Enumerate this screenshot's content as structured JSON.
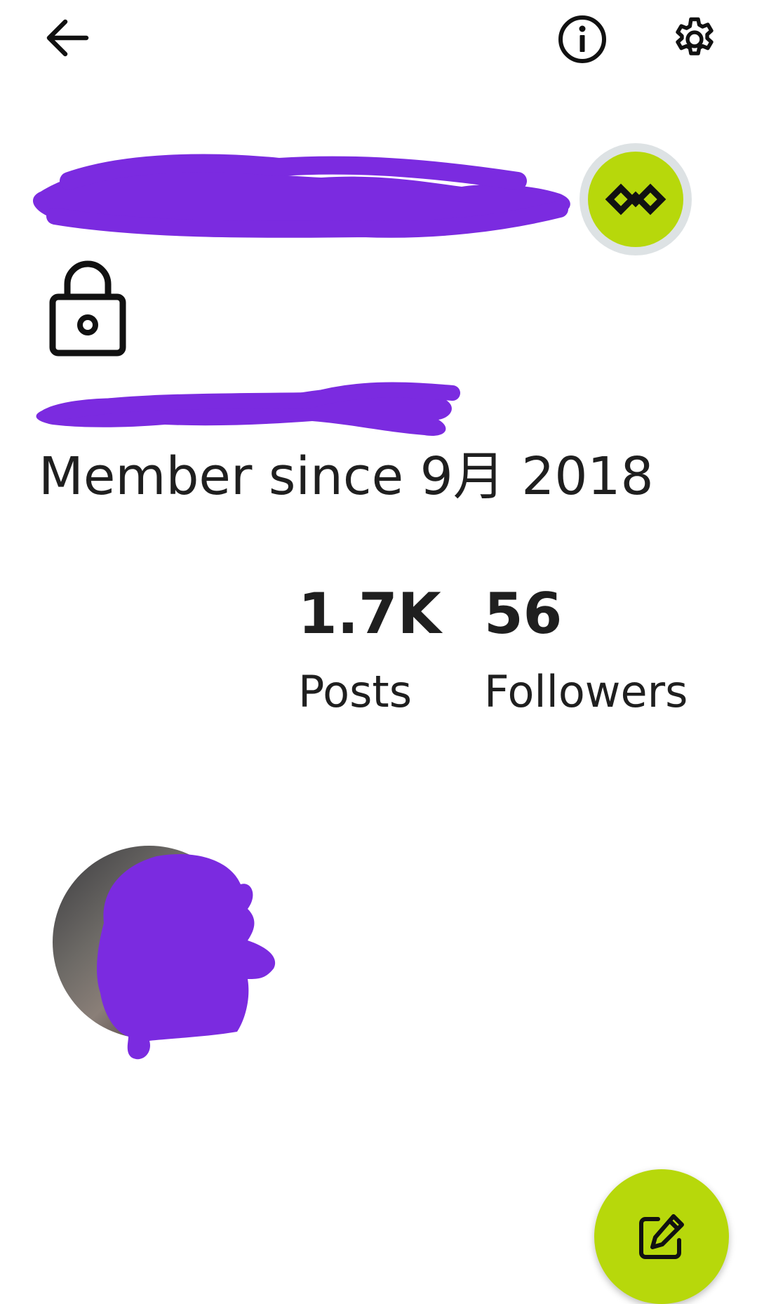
{
  "profile": {
    "member_since": "Member since 9月 2018",
    "posts_count": "1.7K",
    "posts_label": "Posts",
    "followers_count": "56",
    "followers_label": "Followers"
  },
  "icons": {
    "back": "arrow-left-icon",
    "info": "info-icon",
    "settings": "gear-icon",
    "lock": "lock-icon",
    "premium": "infinity-icon",
    "compose": "edit-icon"
  },
  "colors": {
    "accent": "#b7d80b",
    "redaction": "#7b2be0",
    "text": "#1f1f1f",
    "badge_ring": "#dde2e4"
  }
}
